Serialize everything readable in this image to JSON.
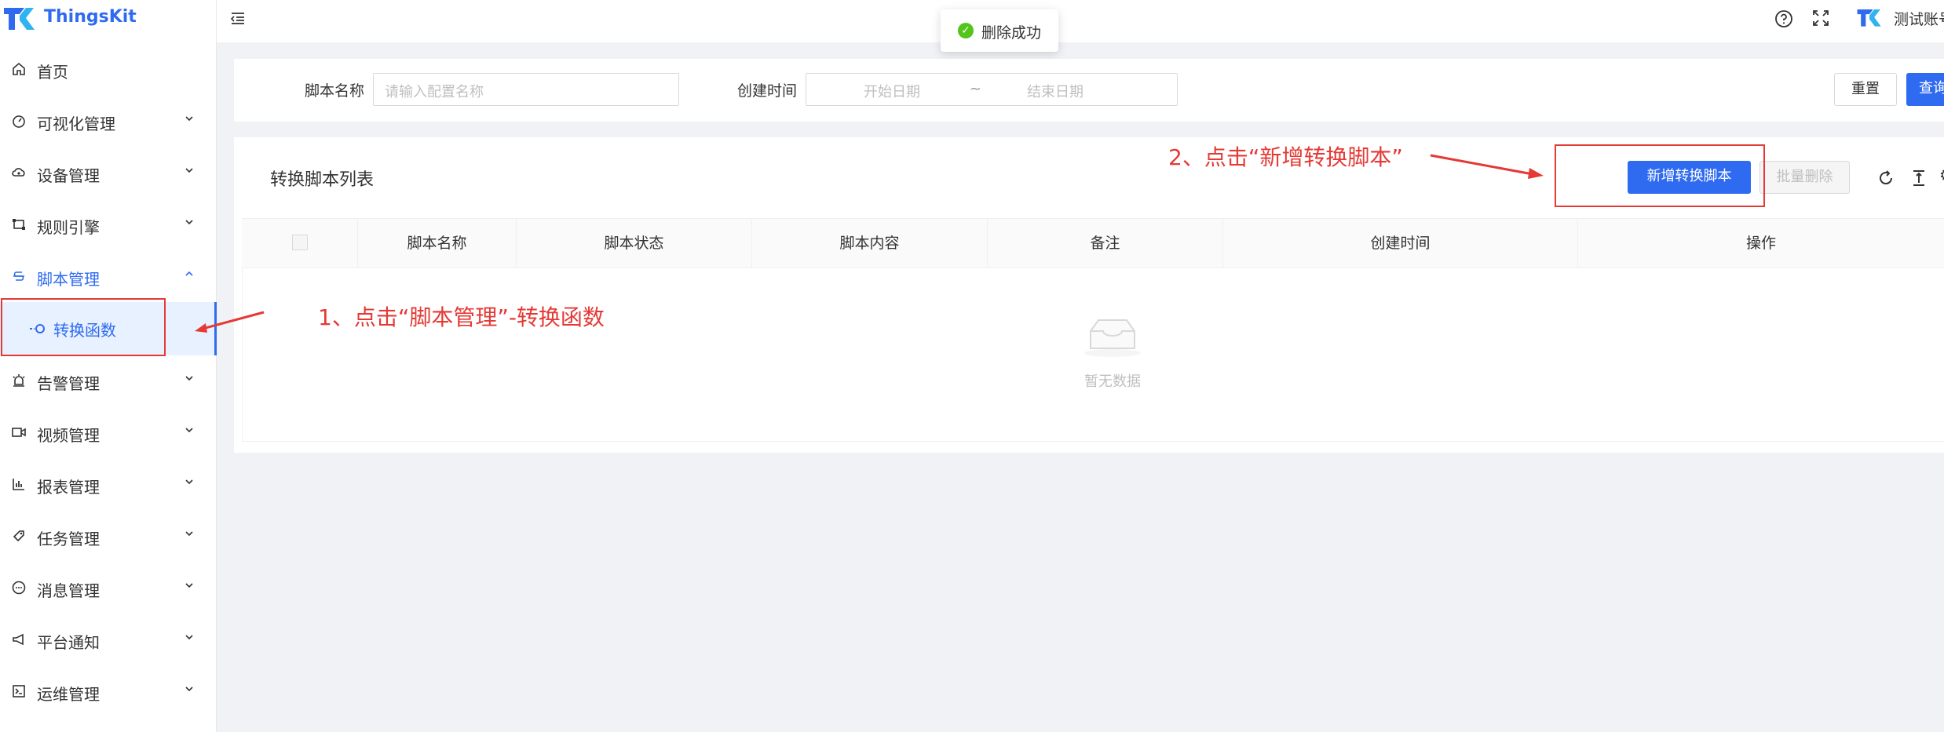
{
  "brand": {
    "name": "ThingsKit",
    "color": "#2f6bf0"
  },
  "header": {
    "collapse_icon": "menu-fold-icon",
    "help_icon": "question-circle-icon",
    "fullscreen_icon": "fullscreen-icon",
    "user_name": "测试账号"
  },
  "toast": {
    "text": "删除成功",
    "status_color": "#52c41a"
  },
  "sidebar": {
    "items": [
      {
        "label": "首页",
        "icon": "home-icon"
      },
      {
        "label": "可视化管理",
        "icon": "dashboard-icon"
      },
      {
        "label": "设备管理",
        "icon": "cloud-device-icon"
      },
      {
        "label": "规则引擎",
        "icon": "rule-icon"
      },
      {
        "label": "脚本管理",
        "icon": "script-icon"
      },
      {
        "label": "告警管理",
        "icon": "alarm-icon"
      },
      {
        "label": "视频管理",
        "icon": "video-icon"
      },
      {
        "label": "报表管理",
        "icon": "report-icon"
      },
      {
        "label": "任务管理",
        "icon": "task-icon"
      },
      {
        "label": "消息管理",
        "icon": "message-icon"
      },
      {
        "label": "平台通知",
        "icon": "notice-icon"
      },
      {
        "label": "运维管理",
        "icon": "ops-icon"
      }
    ],
    "sub_item": {
      "label": "转换函数",
      "icon": "function-icon"
    }
  },
  "search": {
    "name_label": "脚本名称",
    "name_placeholder": "请输入配置名称",
    "time_label": "创建时间",
    "start_placeholder": "开始日期",
    "range_sep": "~",
    "end_placeholder": "结束日期",
    "reset_label": "重置",
    "query_label": "查询"
  },
  "table": {
    "title": "转换脚本列表",
    "add_button": "新增转换脚本",
    "batch_delete_button": "批量删除",
    "columns": [
      "脚本名称",
      "脚本状态",
      "脚本内容",
      "备注",
      "创建时间",
      "操作"
    ],
    "empty_text": "暂无数据"
  },
  "annotations": {
    "step1": "1、点击“脚本管理”-转换函数",
    "step2": "2、点击“新增转换脚本”",
    "color": "#e53935"
  }
}
